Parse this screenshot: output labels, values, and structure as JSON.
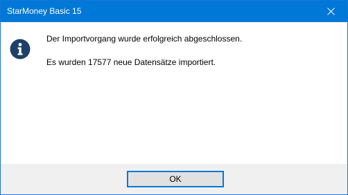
{
  "window": {
    "title": "StarMoney Basic 15",
    "titlebar_color": "#0078d7",
    "close_icon": "close-icon"
  },
  "message": {
    "icon": "info-icon",
    "icon_color": "#1e3f66",
    "line1": "Der Importvorgang wurde erfolgreich abgeschlossen.",
    "line2": "Es wurden 17577 neue Datensätze importiert."
  },
  "footer": {
    "ok_label": "OK"
  }
}
